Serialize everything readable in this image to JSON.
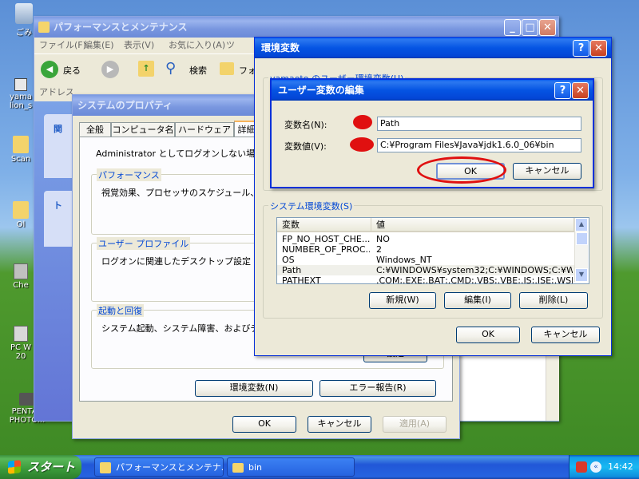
{
  "desktop": {
    "icons": [
      {
        "label": "ごみ"
      },
      {
        "label": "yama"
      },
      {
        "label": "lion_s"
      },
      {
        "label": "Scan"
      },
      {
        "label": "Ol"
      },
      {
        "label": "Che"
      },
      {
        "label": "PC W"
      },
      {
        "label": "20"
      },
      {
        "label": "PENTAX"
      },
      {
        "label": "PHOTO..."
      }
    ]
  },
  "explorer": {
    "title": "パフォーマンスとメンテナンス",
    "menu": [
      "ファイル(F)",
      "編集(E)",
      "表示(V)",
      "お気に入り(A)",
      "ツ"
    ],
    "back_label": "戻る",
    "search_label": "検索",
    "folder_label": "フォ",
    "address_label": "アドレス",
    "side_labels": [
      "関",
      "ト"
    ]
  },
  "sysprops": {
    "title": "システムのプロパティ",
    "tabs": [
      "全般",
      "コンピュータ名",
      "ハードウェア",
      "詳細設"
    ],
    "admin_note": "Administrator としてログオンしない場合は",
    "perf_title": "パフォーマンス",
    "perf_text": "視覚効果、プロセッサのスケジュール、メモ",
    "profile_title": "ユーザー プロファイル",
    "profile_text": "ログオンに関連したデスクトップ設定",
    "startup_title": "起動と回復",
    "startup_text": "システム起動、システム障害、およびデバ",
    "startup_button": "設定",
    "env_button": "環境変数(N)",
    "error_button": "エラー報告(R)",
    "ok": "OK",
    "cancel": "キャンセル",
    "apply": "適用(A)"
  },
  "envvars": {
    "title": "環境変数",
    "user_group_label": "yamaoto のユーザー環境変数(U)",
    "system_group_label": "システム環境変数(S)",
    "columns": [
      "変数",
      "値"
    ],
    "rows": [
      {
        "name": "FP_NO_HOST_CHE...",
        "value": "NO"
      },
      {
        "name": "NUMBER_OF_PROC...",
        "value": "2"
      },
      {
        "name": "OS",
        "value": "Windows_NT"
      },
      {
        "name": "Path",
        "value": "C:¥WINDOWS¥system32;C:¥WINDOWS;C:¥WIN..."
      },
      {
        "name": "PATHEXT",
        "value": ".COM;.EXE;.BAT;.CMD;.VBS;.VBE;.JS;.JSE;.WSF;"
      }
    ],
    "new_button": "新規(W)",
    "edit_button": "編集(I)",
    "delete_button": "削除(L)",
    "ok": "OK",
    "cancel": "キャンセル"
  },
  "editdialog": {
    "title": "ユーザー変数の編集",
    "name_label": "変数名(N):",
    "name_value": "Path",
    "value_label": "変数値(V):",
    "value_value": "C:¥Program Files¥Java¥jdk1.6.0_06¥bin",
    "ok": "OK",
    "cancel": "キャンセル"
  },
  "taskbar": {
    "start": "スタート",
    "tasks": [
      {
        "label": "パフォーマンスとメンテナ..."
      },
      {
        "label": "bin"
      }
    ],
    "clock": "14:42"
  },
  "colors": {
    "annotation_red": "#e01010",
    "titlebar_active": "#0554e3",
    "dialog_bg": "#ece9d8"
  }
}
